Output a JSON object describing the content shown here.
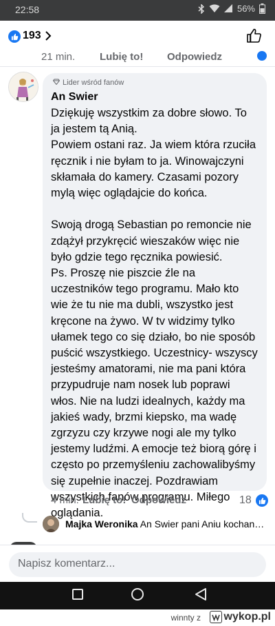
{
  "status_bar": {
    "time": "22:58",
    "battery": "56%",
    "icons": [
      "bluetooth-icon",
      "wifi-icon",
      "signal-icon",
      "battery-icon"
    ]
  },
  "reactions": {
    "count": "193",
    "icon": "like-reaction-icon"
  },
  "previous_comment": {
    "time": "21 min.",
    "like_label": "Lubię to!",
    "reply_label": "Odpowiedz"
  },
  "comment": {
    "badge": "Lider wśród fanów",
    "author": "An Swier",
    "text": "Dziękuję wszystkim za dobre słowo. To ja jestem tą Anią.\nPowiem  ostani raz. Ja wiem która rzuciła ręcznik i nie byłam to ja. Winowajczyni skłamała do kamery. Czasami pozory mylą więc oglądajcie do końca.\n\n Swoją drogą Sebastian po remoncie nie zdążył przykręcić wieszaków więc nie było gdzie tego ręcznika powiesić.\nPs. Proszę nie piszcie źle na uczestników tego programu. Mało kto wie że tu nie ma dubli, wszystko jest kręcone na żywo. W tv widzimy tylko ułamek tego co się działo, bo nie sposób puścić wszystkiego. Uczestnicy- wszyscy jesteśmy amatorami, nie ma pani która przypudruje nam nosek lub poprawi włos. Nie na ludzi idealnych, każdy ma jakieś wady, brzmi kiepsko, ma wadę zgrzyzu czy krzywe nogi ale my tylko jestemy ludźmi. A emocje też biorą górę i często po przemyśleniu zachowalibyśmy się zupełnie inaczej. Pozdrawiam wszystkich fanów programu. Miłego oglądania.",
    "time": "4 min.",
    "like_label": "Lubię to!",
    "reply_label": "Odpowiedz",
    "reaction_count": "18"
  },
  "reply_preview": {
    "author": "Majka Weronika",
    "text": "An Swier pani Aniu kochana,..."
  },
  "composer": {
    "placeholder": "Napisz komentarz..."
  },
  "watermark": {
    "user": "winnty",
    "separator": "z",
    "site": "wykop.pl"
  },
  "colors": {
    "accent": "#1877f2",
    "bubble": "#f0f2f5",
    "secondary_text": "#65676b"
  }
}
